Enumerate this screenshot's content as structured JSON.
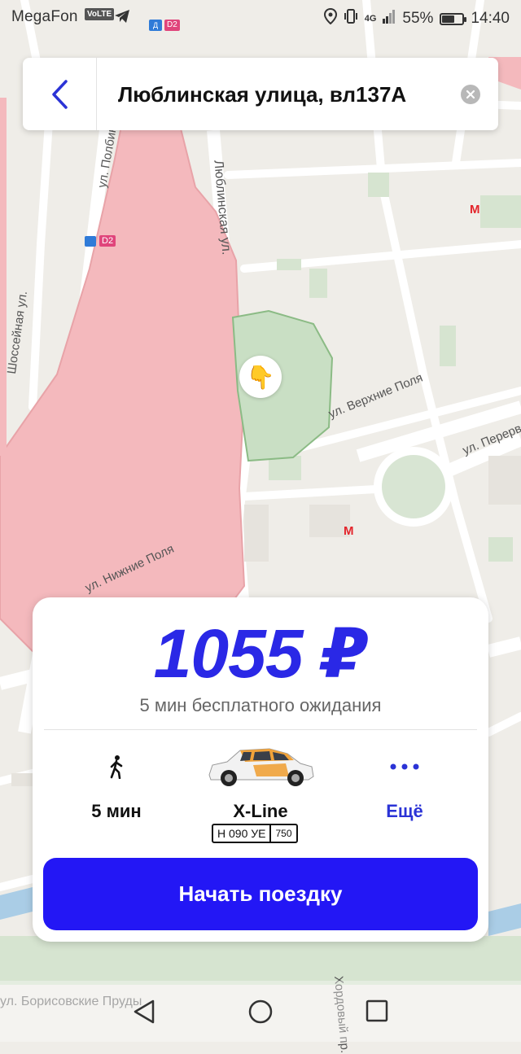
{
  "status_bar": {
    "carrier": "MegaFon",
    "volte": "VoLTE",
    "mini_badge_1": "Д",
    "mini_badge_2": "D2",
    "network": "4G",
    "battery_percent": "55%",
    "battery_level": 0.55,
    "time": "14:40"
  },
  "search": {
    "address": "Люблинская улица, вл137А"
  },
  "map": {
    "streets": [
      "Люблинская ул.",
      "ул. Полбина",
      "Шоссейная ул.",
      "ул. Верхние Поля",
      "ул. Нижние Поля",
      "ул. Перерва",
      "ул. Борисовские Пруды",
      "Хордовый пр."
    ],
    "train_badge": "D2",
    "metro_symbol": "М",
    "pin_emoji": "👇"
  },
  "card": {
    "price": "1055 ₽",
    "free_wait": "5 мин бесплатного ожидания",
    "walk_time": "5 мин",
    "car_model": "X-Line",
    "plate_number": "Н 090 УЕ",
    "plate_region": "750",
    "more_label": "Ещё",
    "start_button": "Начать поездку"
  },
  "colors": {
    "accent": "#2317f5",
    "price": "#2a28e6",
    "zone_red": "#f4b9bd",
    "park_green": "#c9dfc4"
  }
}
